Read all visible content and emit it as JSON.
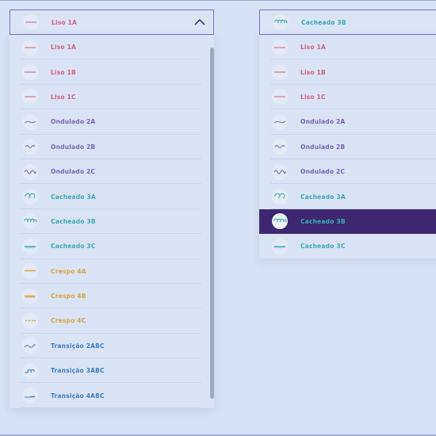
{
  "colors": {
    "liso": "#d0647d",
    "ondulado": "#7a63b8",
    "cacheado": "#3aaab8",
    "crespo": "#d9a441",
    "transicao": "#3a7fc2",
    "selected_bg": "#3c2770",
    "border": "#7b73c9"
  },
  "left_dropdown": {
    "selected_label": "Liso 1A",
    "selected_icon": "liso-1a-icon",
    "chevron": "chevron-up-icon",
    "options": [
      {
        "label": "Liso 1A",
        "icon": "liso-1a-icon",
        "group": "liso"
      },
      {
        "label": "Liso 1B",
        "icon": "liso-1b-icon",
        "group": "liso"
      },
      {
        "label": "Liso 1C",
        "icon": "liso-1c-icon",
        "group": "liso"
      },
      {
        "label": "Ondulado 2A",
        "icon": "ondulado-2a-icon",
        "group": "ondulado"
      },
      {
        "label": "Ondulado 2B",
        "icon": "ondulado-2b-icon",
        "group": "ondulado"
      },
      {
        "label": "Ondulado 2C",
        "icon": "ondulado-2c-icon",
        "group": "ondulado"
      },
      {
        "label": "Cacheado 3A",
        "icon": "cacheado-3a-icon",
        "group": "cacheado"
      },
      {
        "label": "Cacheado 3B",
        "icon": "cacheado-3b-icon",
        "group": "cacheado"
      },
      {
        "label": "Cacheado 3C",
        "icon": "cacheado-3c-icon",
        "group": "cacheado"
      },
      {
        "label": "Crespo 4A",
        "icon": "crespo-4a-icon",
        "group": "crespo"
      },
      {
        "label": "Crespo 4B",
        "icon": "crespo-4b-icon",
        "group": "crespo"
      },
      {
        "label": "Crespo 4C",
        "icon": "crespo-4c-icon",
        "group": "crespo"
      },
      {
        "label": "Transição 2ABC",
        "icon": "transicao-2abc-icon",
        "group": "transicao"
      },
      {
        "label": "Transição 3ABC",
        "icon": "transicao-3abc-icon",
        "group": "transicao"
      },
      {
        "label": "Transição 4ABC",
        "icon": "transicao-4abc-icon",
        "group": "transicao"
      }
    ]
  },
  "right_dropdown": {
    "selected_label": "Cacheado 3B",
    "selected_icon": "cacheado-3b-icon",
    "highlighted_option": "Cacheado 3B",
    "options": [
      {
        "label": "Liso 1A",
        "icon": "liso-1a-icon",
        "group": "liso"
      },
      {
        "label": "Liso 1B",
        "icon": "liso-1b-icon",
        "group": "liso"
      },
      {
        "label": "Liso 1C",
        "icon": "liso-1c-icon",
        "group": "liso"
      },
      {
        "label": "Ondulado 2A",
        "icon": "ondulado-2a-icon",
        "group": "ondulado"
      },
      {
        "label": "Ondulado 2B",
        "icon": "ondulado-2b-icon",
        "group": "ondulado"
      },
      {
        "label": "Ondulado 2C",
        "icon": "ondulado-2c-icon",
        "group": "ondulado"
      },
      {
        "label": "Cacheado 3A",
        "icon": "cacheado-3a-icon",
        "group": "cacheado"
      },
      {
        "label": "Cacheado 3B",
        "icon": "cacheado-3b-icon",
        "group": "cacheado"
      },
      {
        "label": "Cacheado 3C",
        "icon": "cacheado-3c-icon",
        "group": "cacheado"
      }
    ]
  }
}
